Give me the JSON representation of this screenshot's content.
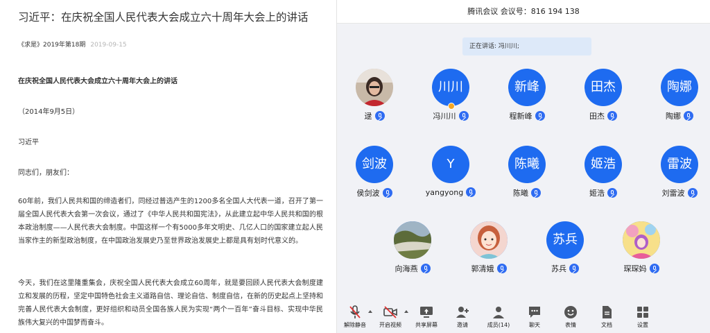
{
  "article": {
    "title": "习近平：在庆祝全国人民代表大会成立六十周年大会上的讲话",
    "source": "《求是》2019年第18期",
    "date": "2019-09-15",
    "subtitle": "在庆祝全国人民代表大会成立六十周年大会上的讲话",
    "speech_date": "（2014年9月5日）",
    "author": "习近平",
    "greeting": "同志们，朋友们：",
    "paragraph1": "60年前，我们人民共和国的缔造者们，同经过普选产生的1200多名全国人大代表一道，召开了第一届全国人民代表大会第一次会议，通过了《中华人民共和国宪法》，从此建立起中华人民共和国的根本政治制度——人民代表大会制度。中国这样一个有5000多年文明史、几亿人口的国家建立起人民当家作主的新型政治制度，在中国政治发展史乃至世界政治发展史上都是具有划时代意义的。",
    "paragraph2": "今天，我们在这里隆重集会，庆祝全国人民代表大会成立60周年，就是要回顾人民代表大会制度建立和发展的历程，坚定中国特色社会主义道路自信、理论自信、制度自信，在新的历史起点上坚持和完善人民代表大会制度，更好组织和动员全国各族人民为实现“两个一百年”奋斗目标、实现中华民族伟大复兴的中国梦而奋斗。"
  },
  "meeting": {
    "header": "腾讯会议 会议号：816 194 138",
    "speaking": "正在讲话: 冯川川;",
    "participants": [
      {
        "name": "逯",
        "avatar_text": "",
        "avatar_type": "photo-woman"
      },
      {
        "name": "冯川川",
        "avatar_text": "川川",
        "avatar_type": "text",
        "host": true
      },
      {
        "name": "程新峰",
        "avatar_text": "新峰",
        "avatar_type": "text"
      },
      {
        "name": "田杰",
        "avatar_text": "田杰",
        "avatar_type": "text"
      },
      {
        "name": "陶娜",
        "avatar_text": "陶娜",
        "avatar_type": "text"
      },
      {
        "name": "侯剑波",
        "avatar_text": "剑波",
        "avatar_type": "text"
      },
      {
        "name": "yangyong",
        "avatar_text": "Y",
        "avatar_type": "text"
      },
      {
        "name": "陈曦",
        "avatar_text": "陈曦",
        "avatar_type": "text"
      },
      {
        "name": "姬浩",
        "avatar_text": "姬浩",
        "avatar_type": "text"
      },
      {
        "name": "刘雷波",
        "avatar_text": "雷波",
        "avatar_type": "text"
      },
      {
        "name": "向海燕",
        "avatar_text": "",
        "avatar_type": "photo-landscape"
      },
      {
        "name": "郭清娥",
        "avatar_text": "",
        "avatar_type": "photo-cartoon"
      },
      {
        "name": "苏兵",
        "avatar_text": "苏兵",
        "avatar_type": "text"
      },
      {
        "name": "琛琛妈",
        "avatar_text": "",
        "avatar_type": "photo-colorful"
      }
    ],
    "toolbar": {
      "unmute": "解除静音",
      "video": "开启视频",
      "share": "共享屏幕",
      "invite": "邀请",
      "members": "成员(14)",
      "chat": "聊天",
      "reactions": "表情",
      "docs": "文档",
      "settings": "设置"
    },
    "colors": {
      "accent": "#1e6bf0",
      "background": "#f1f2f6",
      "speaking_bg": "#dde9f9"
    }
  }
}
